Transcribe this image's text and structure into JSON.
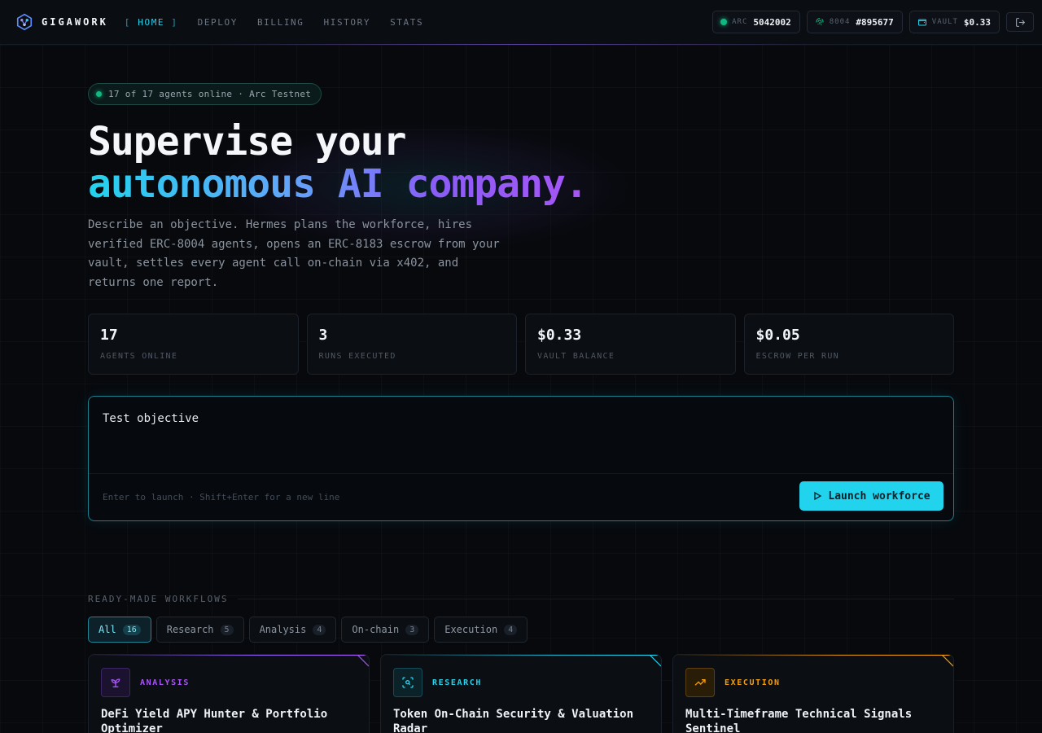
{
  "brand": {
    "name": "GIGAWORK"
  },
  "nav": {
    "items": [
      {
        "label": "HOME",
        "active": true
      },
      {
        "label": "DEPLOY",
        "active": false
      },
      {
        "label": "BILLING",
        "active": false
      },
      {
        "label": "HISTORY",
        "active": false
      },
      {
        "label": "STATS",
        "active": false
      }
    ]
  },
  "header_pills": {
    "arc": {
      "label": "ARC",
      "value": "5042002"
    },
    "erc": {
      "label": "8004",
      "value": "#895677"
    },
    "vault": {
      "label": "VAULT",
      "value": "$0.33"
    }
  },
  "hero": {
    "status": "17 of 17 agents online · Arc Testnet",
    "title_line1": "Supervise your",
    "title_line2": "autonomous AI company.",
    "description": "Describe an objective. Hermes plans the workforce, hires verified ERC-8004 agents, opens an ERC-8183 escrow from your vault, settles every agent call on-chain via x402, and returns one report."
  },
  "stats": [
    {
      "value": "17",
      "label": "AGENTS ONLINE"
    },
    {
      "value": "3",
      "label": "RUNS EXECUTED"
    },
    {
      "value": "$0.33",
      "label": "VAULT BALANCE"
    },
    {
      "value": "$0.05",
      "label": "ESCROW PER RUN"
    }
  ],
  "composer": {
    "value": "Test objective",
    "hint": "Enter to launch · Shift+Enter for a new line",
    "launch_label": "Launch workforce"
  },
  "workflows": {
    "heading": "READY-MADE WORKFLOWS",
    "filters": [
      {
        "label": "All",
        "count": "16",
        "active": true
      },
      {
        "label": "Research",
        "count": "5",
        "active": false
      },
      {
        "label": "Analysis",
        "count": "4",
        "active": false
      },
      {
        "label": "On-chain",
        "count": "3",
        "active": false
      },
      {
        "label": "Execution",
        "count": "4",
        "active": false
      }
    ],
    "cards": [
      {
        "tag": "ANALYSIS",
        "title": "DeFi Yield APY Hunter & Portfolio Optimizer",
        "color": "#a855f7",
        "icon": "sprout-icon"
      },
      {
        "tag": "RESEARCH",
        "title": "Token On-Chain Security & Valuation Radar",
        "color": "#22d3ee",
        "icon": "scan-search-icon"
      },
      {
        "tag": "EXECUTION",
        "title": "Multi-Timeframe Technical Signals Sentinel",
        "color": "#f59e0b",
        "icon": "trending-up-icon"
      }
    ]
  },
  "colors": {
    "accent": "#22d3ee",
    "violet": "#8b5cf6",
    "green": "#10b981",
    "amber": "#f59e0b"
  }
}
